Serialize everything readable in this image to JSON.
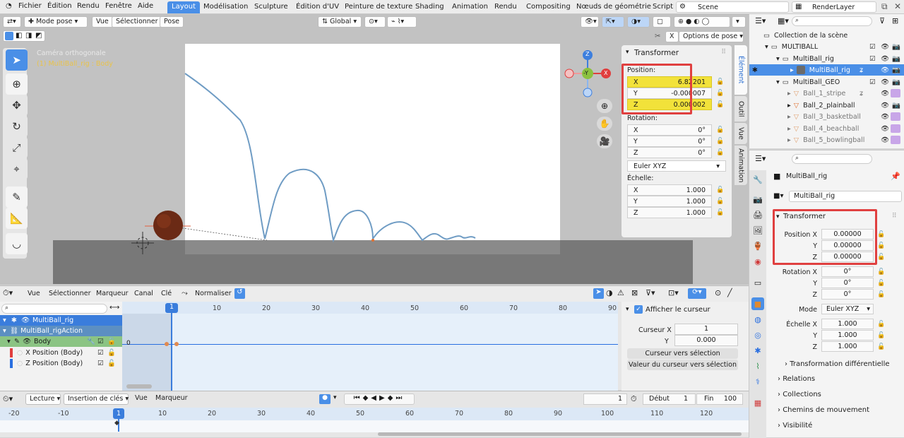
{
  "menu": [
    "Fichier",
    "Édition",
    "Rendu",
    "Fenêtre",
    "Aide"
  ],
  "workspaces": [
    "Layout",
    "Modélisation",
    "Sculpture",
    "Édition d'UV",
    "Peinture de texture",
    "Shading",
    "Animation",
    "Rendu",
    "Compositing",
    "Nœuds de géométrie",
    "Script"
  ],
  "scene": "Scene",
  "render_layer": "RenderLayer",
  "viewport": {
    "mode": "Mode pose",
    "view": "Vue",
    "select": "Sélectionner",
    "pose": "Pose",
    "orientation": "Global",
    "x_label": "X",
    "pose_options": "Options de pose",
    "overlay_line1": "Caméra orthogonale",
    "overlay_line2": "(1) MultiBall_rig : Body",
    "gizmo": {
      "z": "Z",
      "y": "-Y",
      "x": "X"
    }
  },
  "npanel": {
    "title": "Transformer",
    "position_label": "Position:",
    "position": [
      {
        "axis": "X",
        "value": "6.82201"
      },
      {
        "axis": "Y",
        "value": "-0.000007"
      },
      {
        "axis": "Z",
        "value": "0.000002"
      }
    ],
    "rotation_label": "Rotation:",
    "rotation": [
      {
        "axis": "X",
        "value": "0°"
      },
      {
        "axis": "Y",
        "value": "0°"
      },
      {
        "axis": "Z",
        "value": "0°"
      }
    ],
    "rotation_mode": "Euler XYZ",
    "scale_label": "Échelle:",
    "scale": [
      {
        "axis": "X",
        "value": "1.000"
      },
      {
        "axis": "Y",
        "value": "1.000"
      },
      {
        "axis": "Z",
        "value": "1.000"
      }
    ],
    "tabs": [
      "Élément",
      "Outil",
      "Vue",
      "Animation"
    ]
  },
  "dopesheet": {
    "menu": [
      "Vue",
      "Sélectionner",
      "Marqueur",
      "Canal",
      "Clé"
    ],
    "normalize": "Normaliser",
    "current_frame": "1",
    "frames": [
      "10",
      "20",
      "30",
      "40",
      "50",
      "60",
      "70",
      "80",
      "90"
    ],
    "channels": [
      "MultiBall_rig",
      "MultiBall_rigAction",
      "Body",
      "X Position (Body)",
      "Z Position (Body)"
    ],
    "key_value": "0",
    "cursor_panel": {
      "show_cursor": "Afficher le curseur",
      "cursor_x_label": "Curseur X",
      "cursor_x": "1",
      "y_label": "Y",
      "y": "0.000",
      "to_selection": "Curseur vers sélection",
      "value_to_selection": "Valeur du curseur vers sélection"
    }
  },
  "timeline": {
    "playback": "Lecture",
    "keying": "Insertion de clés",
    "view": "Vue",
    "marker": "Marqueur",
    "frame": "1",
    "start_label": "Début",
    "start": "1",
    "end_label": "Fin",
    "end": "100",
    "ruler": [
      "-20",
      "-10",
      "1",
      "10",
      "20",
      "30",
      "40",
      "50",
      "60",
      "70",
      "80",
      "90",
      "100",
      "110",
      "120"
    ]
  },
  "outliner": [
    {
      "label": "Collection de la scène",
      "indent": 0
    },
    {
      "label": "MULTIBALL",
      "indent": 1
    },
    {
      "label": "MultiBall_rig",
      "indent": 2
    },
    {
      "label": "MultiBall_rig",
      "indent": 3
    },
    {
      "label": "MultiBall_GEO",
      "indent": 2
    },
    {
      "label": "Ball_1_stripe",
      "indent": 3
    },
    {
      "label": "Ball_2_plainball",
      "indent": 3
    },
    {
      "label": "Ball_3_basketball",
      "indent": 3
    },
    {
      "label": "Ball_4_beachball",
      "indent": 3
    },
    {
      "label": "Ball_5_bowlingball",
      "indent": 3
    }
  ],
  "properties": {
    "object_name": "MultiBall_rig",
    "object_field": "MultiBall_rig",
    "section": "Transformer",
    "location_labels": [
      "Position X",
      "Y",
      "Z"
    ],
    "location": [
      "0.00000",
      "0.00000",
      "0.00000"
    ],
    "rotation_labels": [
      "Rotation X",
      "Y",
      "Z"
    ],
    "rotation": [
      "0°",
      "0°",
      "0°"
    ],
    "mode_label": "Mode",
    "mode": "Euler XYZ",
    "scale_labels": [
      "Échelle X",
      "Y",
      "Z"
    ],
    "scale": [
      "1.000",
      "1.000",
      "1.000"
    ],
    "delta": "Transformation différentielle",
    "panels": [
      "Relations",
      "Collections",
      "Chemins de mouvement",
      "Visibilité"
    ]
  },
  "colors": {
    "accent": "#4a8fe7",
    "highlight": "#f2e23a",
    "annotation": "#e04040",
    "curve": "#6f9cc4"
  }
}
